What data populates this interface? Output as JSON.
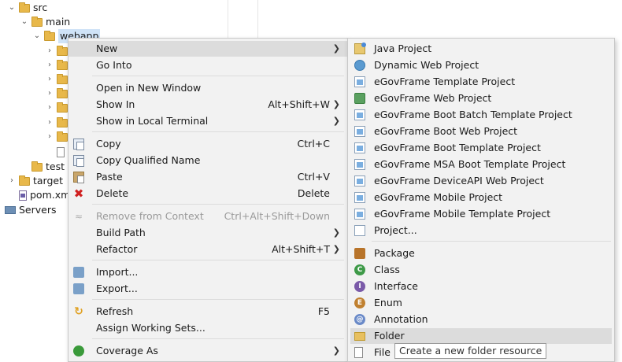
{
  "tree": {
    "items": [
      {
        "label": "src"
      },
      {
        "label": "main"
      },
      {
        "label": "webapp"
      },
      {
        "label": "test"
      },
      {
        "label": "target"
      },
      {
        "label": "pom.xml"
      },
      {
        "label": "Servers"
      }
    ]
  },
  "context_menu": {
    "items": [
      {
        "label": "New",
        "shortcut": ""
      },
      {
        "label": "Go Into",
        "shortcut": ""
      },
      {
        "label": "Open in New Window",
        "shortcut": ""
      },
      {
        "label": "Show In",
        "shortcut": "Alt+Shift+W"
      },
      {
        "label": "Show in Local Terminal",
        "shortcut": ""
      },
      {
        "label": "Copy",
        "shortcut": "Ctrl+C"
      },
      {
        "label": "Copy Qualified Name",
        "shortcut": ""
      },
      {
        "label": "Paste",
        "shortcut": "Ctrl+V"
      },
      {
        "label": "Delete",
        "shortcut": "Delete"
      },
      {
        "label": "Remove from Context",
        "shortcut": "Ctrl+Alt+Shift+Down"
      },
      {
        "label": "Build Path",
        "shortcut": ""
      },
      {
        "label": "Refactor",
        "shortcut": "Alt+Shift+T"
      },
      {
        "label": "Import...",
        "shortcut": ""
      },
      {
        "label": "Export...",
        "shortcut": ""
      },
      {
        "label": "Refresh",
        "shortcut": "F5"
      },
      {
        "label": "Assign Working Sets...",
        "shortcut": ""
      },
      {
        "label": "Coverage As",
        "shortcut": ""
      }
    ]
  },
  "new_submenu": {
    "items": [
      {
        "label": "Java Project"
      },
      {
        "label": "Dynamic Web Project"
      },
      {
        "label": "eGovFrame Template Project"
      },
      {
        "label": "eGovFrame Web Project"
      },
      {
        "label": "eGovFrame Boot Batch Template Project"
      },
      {
        "label": "eGovFrame Boot Web Project"
      },
      {
        "label": "eGovFrame Boot Template Project"
      },
      {
        "label": "eGovFrame MSA Boot Template Project"
      },
      {
        "label": "eGovFrame DeviceAPI Web Project"
      },
      {
        "label": "eGovFrame Mobile Project"
      },
      {
        "label": "eGovFrame Mobile Template Project"
      },
      {
        "label": "Project..."
      },
      {
        "label": "Package"
      },
      {
        "label": "Class"
      },
      {
        "label": "Interface"
      },
      {
        "label": "Enum"
      },
      {
        "label": "Annotation"
      },
      {
        "label": "Folder"
      },
      {
        "label": "File"
      }
    ]
  },
  "tooltip": {
    "text": "Create a new folder resource"
  },
  "icons": {
    "class_letter": "C",
    "interface_letter": "I",
    "enum_letter": "E",
    "annotation_letter": "@"
  }
}
